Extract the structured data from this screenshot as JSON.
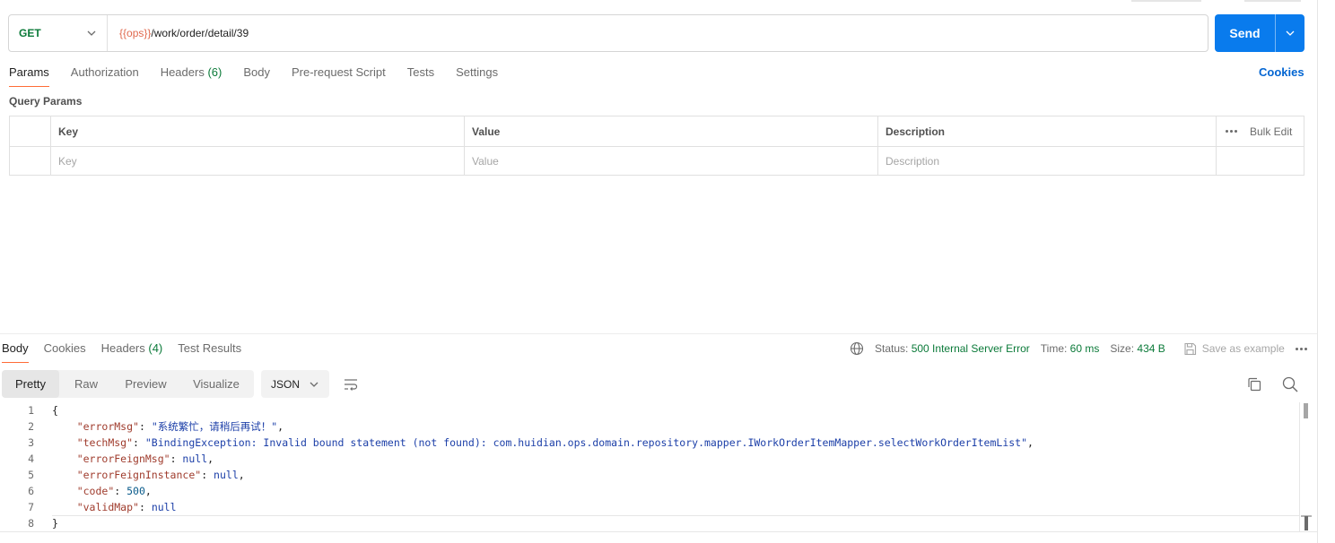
{
  "request": {
    "method": "GET",
    "url_variable": "{{ops}}",
    "url_path": "/work/order/detail/39",
    "send_label": "Send"
  },
  "request_tabs": [
    {
      "label": "Params",
      "active": true
    },
    {
      "label": "Authorization"
    },
    {
      "label": "Headers",
      "count": "(6)"
    },
    {
      "label": "Body"
    },
    {
      "label": "Pre-request Script"
    },
    {
      "label": "Tests"
    },
    {
      "label": "Settings"
    }
  ],
  "cookies_label": "Cookies",
  "query_params": {
    "title": "Query Params",
    "headers": {
      "key": "Key",
      "value": "Value",
      "description": "Description",
      "bulk_edit": "Bulk Edit"
    },
    "placeholders": {
      "key": "Key",
      "value": "Value",
      "description": "Description"
    }
  },
  "response_tabs": [
    {
      "label": "Body",
      "active": true
    },
    {
      "label": "Cookies"
    },
    {
      "label": "Headers",
      "count": "(4)"
    },
    {
      "label": "Test Results"
    }
  ],
  "response_status": {
    "status_label": "Status:",
    "status_value": "500 Internal Server Error",
    "time_label": "Time:",
    "time_value": "60 ms",
    "size_label": "Size:",
    "size_value": "434 B",
    "save_example": "Save as example"
  },
  "view_modes": [
    "Pretty",
    "Raw",
    "Preview",
    "Visualize"
  ],
  "active_view": "Pretty",
  "format": "JSON",
  "body_lines": [
    {
      "n": "1",
      "text": "{"
    },
    {
      "n": "2",
      "key": "\"errorMsg\"",
      "value": "\"系统繁忙，请稍后再试！\"",
      "type": "s",
      "trail": ","
    },
    {
      "n": "3",
      "key": "\"techMsg\"",
      "value": "\"BindingException: Invalid bound statement (not found): com.huidian.ops.domain.repository.mapper.IWorkOrderItemMapper.selectWorkOrderItemList\"",
      "type": "s",
      "trail": ","
    },
    {
      "n": "4",
      "key": "\"errorFeignMsg\"",
      "value": "null",
      "type": "kw",
      "trail": ","
    },
    {
      "n": "5",
      "key": "\"errorFeignInstance\"",
      "value": "null",
      "type": "kw",
      "trail": ","
    },
    {
      "n": "6",
      "key": "\"code\"",
      "value": "500",
      "type": "n",
      "trail": ","
    },
    {
      "n": "7",
      "key": "\"validMap\"",
      "value": "null",
      "type": "kw",
      "trail": ""
    },
    {
      "n": "8",
      "text": "}"
    }
  ],
  "colors": {
    "method_get": "#0b7a39",
    "url_variable": "#e0694e",
    "send_button": "#097bed",
    "status_ok_text": "#0b7a39",
    "active_tab_underline": "#ff6c37"
  }
}
